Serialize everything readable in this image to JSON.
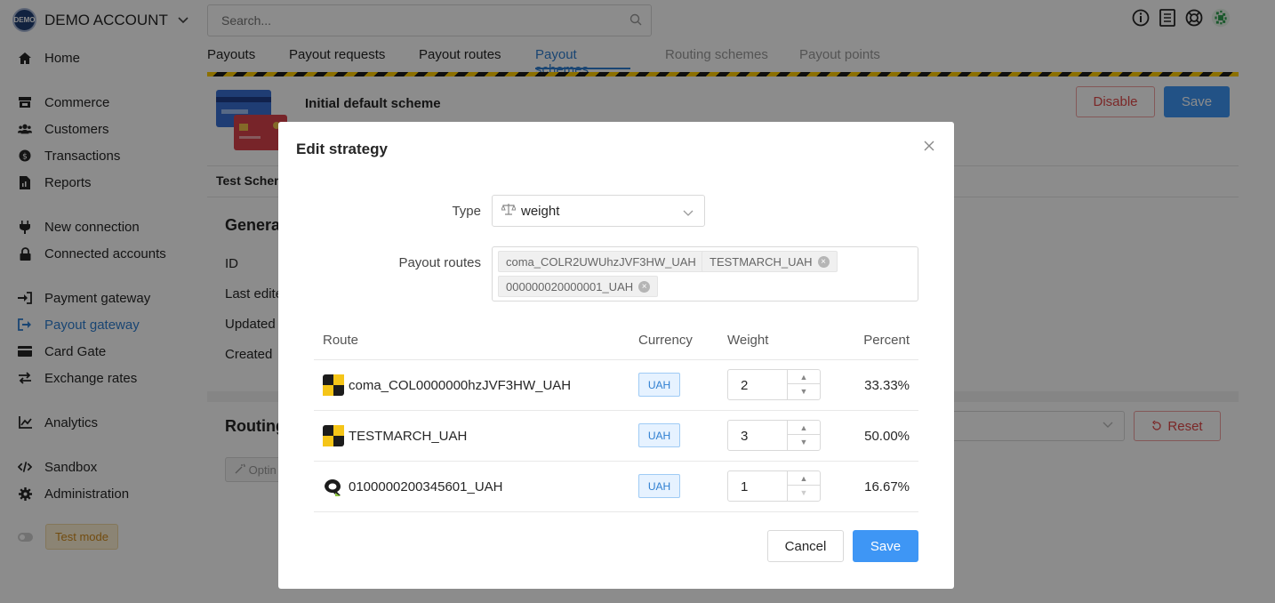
{
  "account": {
    "badge": "DEMO",
    "name": "DEMO ACCOUNT"
  },
  "search": {
    "placeholder": "Search..."
  },
  "sidebar": {
    "items": [
      {
        "label": "Home",
        "icon": "home-icon"
      },
      {
        "label": "Commerce",
        "icon": "store-icon"
      },
      {
        "label": "Customers",
        "icon": "users-icon"
      },
      {
        "label": "Transactions",
        "icon": "dollar-icon"
      },
      {
        "label": "Reports",
        "icon": "report-icon"
      },
      {
        "label": "New connection",
        "icon": "plug-icon"
      },
      {
        "label": "Connected accounts",
        "icon": "lock-icon"
      },
      {
        "label": "Payment gateway",
        "icon": "sign-in-icon"
      },
      {
        "label": "Payout gateway",
        "icon": "sign-out-icon"
      },
      {
        "label": "Card Gate",
        "icon": "card-icon"
      },
      {
        "label": "Exchange rates",
        "icon": "exchange-icon"
      },
      {
        "label": "Analytics",
        "icon": "chart-icon"
      },
      {
        "label": "Sandbox",
        "icon": "code-icon"
      },
      {
        "label": "Administration",
        "icon": "gear-icon"
      }
    ],
    "test_mode": "Test mode"
  },
  "tabs": [
    "Payouts",
    "Payout requests",
    "Payout routes",
    "Payout schemes",
    "Routing schemes",
    "Payout points"
  ],
  "background": {
    "scheme_title": "Initial default scheme",
    "disable": "Disable",
    "save": "Save",
    "test_scheme": "Test Schem",
    "general": "Genera",
    "fields": [
      "ID",
      "Last edite",
      "Updated",
      "Created"
    ],
    "routing": "Routing",
    "optimize": "Optin",
    "reset": "Reset"
  },
  "modal": {
    "title": "Edit strategy",
    "type_label": "Type",
    "type_value": "weight",
    "routes_label": "Payout routes",
    "tags": [
      "coma_COLR2UWUhzJVF3HW_UAH",
      "TESTMARCH_UAH",
      "000000020000001_UAH"
    ],
    "columns": {
      "route": "Route",
      "currency": "Currency",
      "weight": "Weight",
      "percent": "Percent"
    },
    "rows": [
      {
        "route": "coma_COL0000000hzJVF3HW_UAH",
        "currency": "UAH",
        "weight": "2",
        "percent": "33.33%",
        "icon": "checker-icon"
      },
      {
        "route": "TESTMARCH_UAH",
        "currency": "UAH",
        "weight": "3",
        "percent": "50.00%",
        "icon": "checker-icon"
      },
      {
        "route": "0100000200345601_UAH",
        "currency": "UAH",
        "weight": "1",
        "percent": "16.67%",
        "icon": "provider-logo-icon"
      }
    ],
    "cancel": "Cancel",
    "save": "Save"
  },
  "colors": {
    "accent": "#3e96f5",
    "active_link": "#2f7fd1",
    "danger": "#e04848"
  }
}
